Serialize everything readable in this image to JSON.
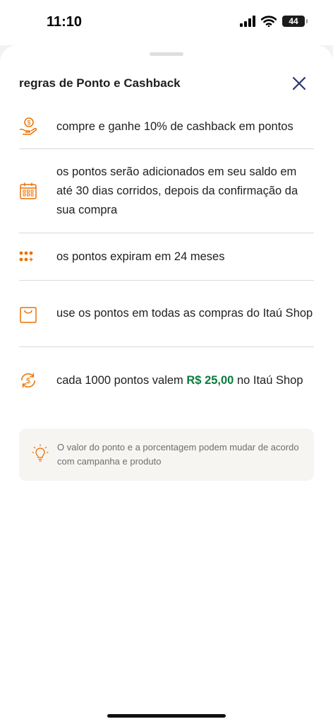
{
  "status_bar": {
    "time": "11:10",
    "battery": "44"
  },
  "sheet": {
    "title": "regras de Ponto e Cashback",
    "rules": [
      {
        "icon": "cashback-hand-icon",
        "text": "compre e ganhe 10% de cashback em pontos"
      },
      {
        "icon": "calendar-icon",
        "text": "os pontos serão adicionados em seu saldo em até 30 dias corridos, depois da confirmação da sua compra"
      },
      {
        "icon": "points-dots-icon",
        "text": "os pontos expiram em 24 meses"
      },
      {
        "icon": "shopping-bag-icon",
        "text": "use os pontos em todas as compras do Itaú Shop"
      },
      {
        "icon": "currency-exchange-icon",
        "text_before": "cada 1000 pontos valem ",
        "text_highlight": "R$ 25,00",
        "text_after": " no Itaú Shop"
      }
    ],
    "info": {
      "icon": "lightbulb-icon",
      "text": "O valor do ponto e a porcentagem podem mudar de acordo com campanha e produto"
    }
  },
  "colors": {
    "accent": "#ec7000",
    "highlight": "#0b7a3b",
    "close": "#2c3570"
  }
}
